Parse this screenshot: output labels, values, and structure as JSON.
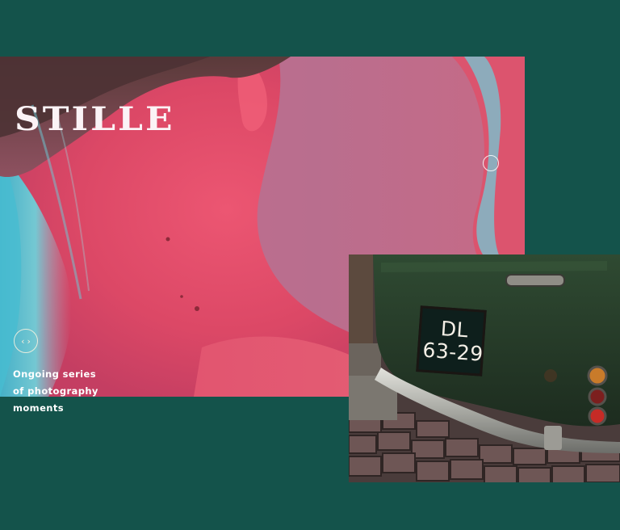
{
  "brand": {
    "logo_text": "STILLE"
  },
  "hero": {
    "caption_lines": [
      "Ongoing series",
      "of photography",
      "moments"
    ],
    "nav_prev_icon": "chevron-left-icon",
    "nav_next_icon": "chevron-right-icon",
    "nav_prev_glyph": "‹",
    "nav_next_glyph": "›"
  },
  "car_photo": {
    "plate_line_1": "DL",
    "plate_line_2": "63-29"
  },
  "colors": {
    "background": "#14534b",
    "hero_pink": "#e24a66",
    "hero_cyan": "#5cc7d6",
    "car_green": "#2a3d2a",
    "text": "#ffffff"
  }
}
